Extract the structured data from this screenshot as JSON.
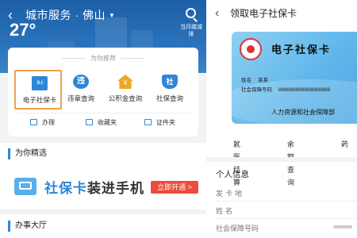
{
  "left": {
    "header": {
      "title": "城市服务 · 佛山",
      "temperature": "27°",
      "search_label": "当月碳减排"
    },
    "recommend": {
      "title": "为你推荐",
      "services": [
        {
          "label": "电子社保卡",
          "icon": "social-card-icon",
          "glyph": "S.I"
        },
        {
          "label": "违章查询",
          "icon": "traffic-icon",
          "glyph": "违"
        },
        {
          "label": "公积金查询",
          "icon": "housing-fund-icon",
          "glyph": "¥"
        },
        {
          "label": "社保查询",
          "icon": "social-security-icon",
          "glyph": "社"
        }
      ],
      "links": [
        {
          "label": "办理"
        },
        {
          "label": "收藏夹"
        },
        {
          "label": "证件夹"
        }
      ]
    },
    "picks": {
      "title": "为你精选",
      "banner_highlight": "社保卡",
      "banner_text": "装进手机",
      "banner_button": "立即开通 >"
    },
    "hall": {
      "title": "办事大厅"
    }
  },
  "right": {
    "header": {
      "title": "领取电子社保卡"
    },
    "card": {
      "title": "电子社保卡",
      "name_label": "姓名",
      "name_value": "某某",
      "id_label": "社会保障号码",
      "id_value": "888888888888888888",
      "org": "人力资源和社会保障部"
    },
    "features": [
      "就医结算",
      "余额查询",
      "药"
    ],
    "info": {
      "title": "个人信息",
      "rows": [
        {
          "label": "发卡地"
        },
        {
          "label": "姓名"
        },
        {
          "label": "社会保障号码"
        }
      ]
    }
  },
  "colors": {
    "accent": "#2f86d8",
    "highlight_border": "#f2a04a",
    "cta": "#ec4c3c"
  }
}
